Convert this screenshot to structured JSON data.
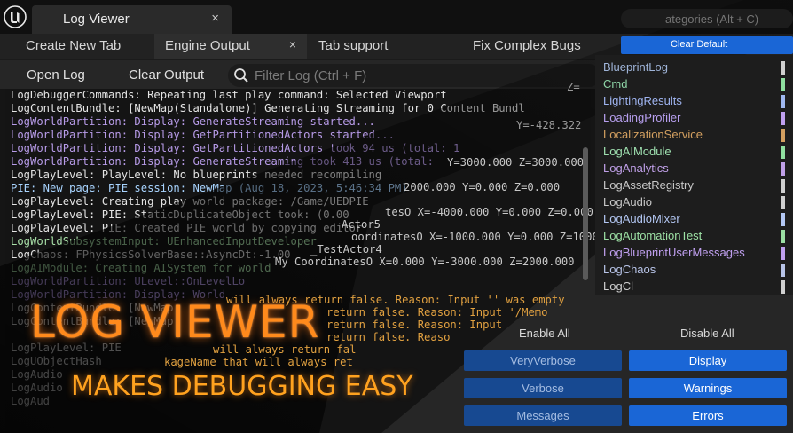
{
  "window": {
    "tab_title": "Log Viewer",
    "close_glyph": "×"
  },
  "subtabs": [
    {
      "label": "Create New Tab"
    },
    {
      "label": "Engine Output",
      "active": true,
      "close_glyph": "×"
    },
    {
      "label": "Tab support"
    },
    {
      "label": "Fix Complex Bugs"
    }
  ],
  "clear_default_label": "Clear Default",
  "toolbar": {
    "open_log": "Open Log",
    "clear_output": "Clear Output",
    "filter_placeholder": "Filter Log (Ctrl + F)"
  },
  "categories": {
    "search_placeholder": "ategories (Alt + C)",
    "items": [
      {
        "label": "BlueprintLog",
        "color": "#9fb4d8",
        "bar": "#d0d0d0"
      },
      {
        "label": "Cmd",
        "color": "#8fd6a8",
        "bar": "#8fe0a0"
      },
      {
        "label": "LightingResults",
        "color": "#9fb4f0",
        "bar": "#a0b8f0"
      },
      {
        "label": "LoadingProfiler",
        "color": "#b8a0f0",
        "bar": "#c0a0f0"
      },
      {
        "label": "LocalizationService",
        "color": "#d4a060",
        "bar": "#d4a060"
      },
      {
        "label": "LogAIModule",
        "color": "#9fe0b0",
        "bar": "#90e0a0"
      },
      {
        "label": "LogAnalytics",
        "color": "#c0a0e8",
        "bar": "#c0a0e8"
      },
      {
        "label": "LogAssetRegistry",
        "color": "#c8c8c8",
        "bar": "#d0d0d0"
      },
      {
        "label": "LogAudio",
        "color": "#c8c8c8",
        "bar": "#d0d0d0"
      },
      {
        "label": "LogAudioMixer",
        "color": "#b4c8f4",
        "bar": "#b4c8f4"
      },
      {
        "label": "LogAutomationTest",
        "color": "#9ce0a4",
        "bar": "#9ce0a4"
      },
      {
        "label": "LogBlueprintUserMessages",
        "color": "#c0a0f0",
        "bar": "#c0a0f0"
      },
      {
        "label": "LogChaos",
        "color": "#b8c4e8",
        "bar": "#b8c4e8"
      },
      {
        "label": "LogCl",
        "color": "#d0d0d0",
        "bar": "#d0d0d0"
      }
    ]
  },
  "log_lines": [
    {
      "text": "LogDebuggerCommands: Repeating last play command: Selected Viewport",
      "color": "#e4e4e4"
    },
    {
      "text": "LogContentBundle: [NewMap(Standalone)] Generating Streaming for 0 Content Bundl",
      "color": "#e4e4e4"
    },
    {
      "text": "LogWorldPartition: Display: GenerateStreaming started...",
      "color": "#b79be8"
    },
    {
      "text": "LogWorldPartition: Display: GetPartitionedActors started...",
      "color": "#b79be8"
    },
    {
      "text": "LogWorldPartition: Display: GetPartitionedActors took 94 us (total: 1",
      "color": "#b79be8"
    },
    {
      "text": "LogWorldPartition: Display: GenerateStreaming took 413 us (total:",
      "color": "#b79be8"
    },
    {
      "text": "LogPlayLevel: PlayLevel: No blueprints needed recompiling",
      "color": "#e4e4e4"
    },
    {
      "text": "PIE: New page: PIE session: NewMap (Aug 18, 2023, 5:46:34 PM)",
      "color": "#a8d4ff"
    },
    {
      "text": "LogPlayLevel: Creating play world package: /Game/UEDPIE",
      "color": "#e4e4e4"
    },
    {
      "text": "LogPlayLevel: PIE: StaticDuplicateObject took: (0.00",
      "color": "#e4e4e4"
    },
    {
      "text": "LogPlayLevel: PIE: Created PIE world by copying editor",
      "color": "#e4e4e4"
    },
    {
      "text": "LogWorldSubsystemInput: UEnhancedInputDeveloper",
      "color": "#a8e0a8"
    },
    {
      "text": "LogChaos: FPhysicsSolverBase::AsyncDt:-1.00",
      "color": "#e4e4e4"
    },
    {
      "text": "LogAIModule: Creating AISystem for world",
      "color": "#a8e0a8"
    },
    {
      "text": "LogWorldPartition: ULevel::OnLevelLo",
      "color": "#b79be8"
    },
    {
      "text": "LogWorldPartition: Display: World",
      "color": "#b79be8"
    },
    {
      "text": "LogContentBundle: [NewMap",
      "color": "#e4e4e4"
    },
    {
      "text": "LogContentBundle: [NewMap",
      "color": "#e4e4e4"
    },
    {
      "text": "LogPlayLevel: PIE",
      "color": "#e4e4e4"
    },
    {
      "text": "LogUObjectHash",
      "color": "#e4e4e4"
    },
    {
      "text": "LogAudio",
      "color": "#e4e4e4"
    },
    {
      "text": "LogAudio",
      "color": "#e4e4e4"
    },
    {
      "text": "LogAud",
      "color": "#e4e4e4"
    }
  ],
  "log_fragments": [
    {
      "text": "Z=",
      "color": "#9a9a9a"
    },
    {
      "text": "Y=-428.322",
      "color": "#9a9a9a"
    },
    {
      "text": "Y=3000.000 Z=3000.000",
      "color": "#c8c8c8"
    },
    {
      "text": "2000.000 Y=0.000 Z=0.000",
      "color": "#c8c8c8"
    },
    {
      "text": "tesO X=-4000.000 Y=0.000 Z=0.000",
      "color": "#c8c8c8"
    },
    {
      "text": "oordinatesO X=-1000.000 Y=0.000 Z=1000.000",
      "color": "#c8c8c8"
    },
    {
      "text": "_TestActor4",
      "color": "#c8c8c8"
    },
    {
      "text": "My CoordinatesO X=0.000 Y=-3000.000 Z=2000.000",
      "color": "#c8c8c8"
    },
    {
      "text": "Actor5",
      "color": "#c8c8c8"
    },
    {
      "text": "will always return false. Reason: Input '' was empty",
      "color": "#e0a040"
    },
    {
      "text": "return false. Reason: Input '/Memo",
      "color": "#e0a040"
    },
    {
      "text": "return false. Reason: Input",
      "color": "#e0a040"
    },
    {
      "text": "return false. Reaso",
      "color": "#e0a040"
    },
    {
      "text": "will always return fal",
      "color": "#e0a040"
    },
    {
      "text": "kageName that will always ret",
      "color": "#e0a040"
    }
  ],
  "verbosity": {
    "enable_all": "Enable All",
    "disable_all": "Disable All",
    "buttons": [
      {
        "label": "VeryVerbose",
        "state": "off"
      },
      {
        "label": "Display",
        "state": "on"
      },
      {
        "label": "Verbose",
        "state": "off"
      },
      {
        "label": "Warnings",
        "state": "on"
      },
      {
        "label": "Messages",
        "state": "off"
      },
      {
        "label": "Errors",
        "state": "on"
      }
    ]
  },
  "headline": {
    "title": "LOG VIEWER",
    "subtitle": "MAKES DEBUGGING EASY"
  }
}
